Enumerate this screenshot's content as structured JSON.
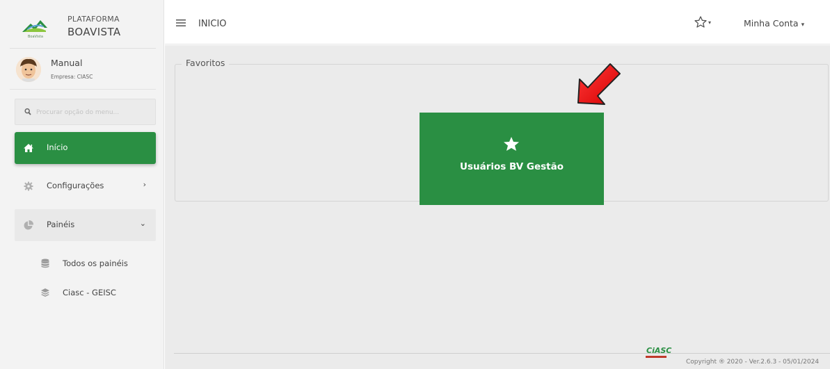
{
  "brand": {
    "line1": "PLATAFORMA",
    "line2": "BOAVISTA",
    "logo_label": "BoaVista"
  },
  "user": {
    "name": "Manual",
    "company": "Empresa: CIASC"
  },
  "search": {
    "placeholder": "Procurar opção do menu..."
  },
  "sidebar": {
    "items": [
      {
        "label": "Início",
        "icon": "home-icon",
        "active": true
      },
      {
        "label": "Configurações",
        "icon": "gear-icon",
        "chevron": "›"
      },
      {
        "label": "Painéis",
        "icon": "pie-chart-icon",
        "chevron": "⌄",
        "expanded": true
      }
    ],
    "subitems": [
      {
        "label": "Todos os painéis",
        "icon": "database-icon"
      },
      {
        "label": "Ciasc - GEISC",
        "icon": "layers-icon"
      }
    ]
  },
  "header": {
    "title": "INICIO",
    "star_caret": "▾",
    "account_label": "Minha Conta",
    "account_caret": "▾"
  },
  "main": {
    "favorites_title": "Favoritos",
    "favorite_tile": {
      "label": "Usuários BV Gestão",
      "icon": "star-icon"
    }
  },
  "footer": {
    "logo": "CiASC",
    "copyright": "Copyright ® 2020 - Ver.2.6.3 - 05/01/2024"
  },
  "colors": {
    "accent_green": "#2a8f43",
    "arrow_red": "#e00000"
  }
}
